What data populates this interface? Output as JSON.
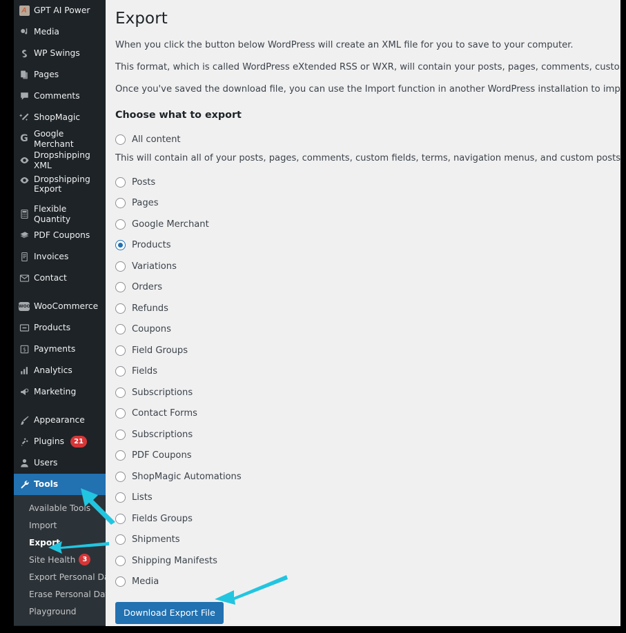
{
  "theme": {
    "sidebar_bg": "#1d2327",
    "submenu_bg": "#2c3338",
    "content_bg": "#f0f0f1",
    "accent_blue": "#2271b1",
    "badge_red": "#d63638",
    "arrow_cyan": "#22c5e0",
    "page_border": "#000000"
  },
  "sidebar": {
    "items": [
      {
        "label": "GPT AI Power",
        "icon": "ai-power-icon",
        "badge": null
      },
      {
        "label": "Media",
        "icon": "media-icon",
        "badge": null
      },
      {
        "label": "WP Swings",
        "icon": "wp-swings-icon",
        "badge": null
      },
      {
        "label": "Pages",
        "icon": "pages-icon",
        "badge": null
      },
      {
        "label": "Comments",
        "icon": "comments-icon",
        "badge": null
      },
      {
        "label": "ShopMagic",
        "icon": "magic-wand-icon",
        "badge": null
      },
      {
        "label": "Google Merchant",
        "icon": "google-g-icon",
        "badge": null
      },
      {
        "label": "Dropshipping XML",
        "icon": "eye-icon",
        "badge": null
      },
      {
        "label": "Dropshipping Export",
        "icon": "eye-icon",
        "badge": null,
        "two_line": true
      },
      {
        "label": "Flexible Quantity",
        "icon": "calculator-icon",
        "badge": null
      },
      {
        "label": "PDF Coupons",
        "icon": "coupon-icon",
        "badge": null
      },
      {
        "label": "Invoices",
        "icon": "invoice-icon",
        "badge": null
      },
      {
        "label": "Contact",
        "icon": "envelope-icon",
        "badge": null
      },
      {
        "label": "WooCommerce",
        "icon": "woocommerce-icon",
        "badge": null,
        "separator_before": true
      },
      {
        "label": "Products",
        "icon": "product-box-icon",
        "badge": null
      },
      {
        "label": "Payments",
        "icon": "payments-icon",
        "badge": null
      },
      {
        "label": "Analytics",
        "icon": "analytics-bars-icon",
        "badge": null
      },
      {
        "label": "Marketing",
        "icon": "megaphone-icon",
        "badge": null
      },
      {
        "label": "Appearance",
        "icon": "paintbrush-icon",
        "badge": null,
        "separator_before": true
      },
      {
        "label": "Plugins",
        "icon": "plug-icon",
        "badge": "21"
      },
      {
        "label": "Users",
        "icon": "user-icon",
        "badge": null
      },
      {
        "label": "Tools",
        "icon": "wrench-icon",
        "badge": null,
        "current": true
      }
    ],
    "submenu": [
      {
        "label": "Available Tools",
        "current": false
      },
      {
        "label": "Import",
        "current": false
      },
      {
        "label": "Export",
        "current": true
      },
      {
        "label": "Site Health",
        "current": false,
        "badge": "3"
      },
      {
        "label": "Export Personal Data",
        "current": false
      },
      {
        "label": "Erase Personal Data",
        "current": false
      },
      {
        "label": "Playground",
        "current": false
      }
    ]
  },
  "main": {
    "title": "Export",
    "paragraphs": [
      "When you click the button below WordPress will create an XML file for you to save to your computer.",
      "This format, which is called WordPress eXtended RSS or WXR, will contain your posts, pages, comments, custom fields, categories, and tags.",
      "Once you've saved the download file, you can use the Import function in another WordPress installation to import the content from this site."
    ],
    "choose_heading": "Choose what to export",
    "all_content": {
      "label": "All content",
      "checked": false,
      "description": "This will contain all of your posts, pages, comments, custom fields, terms, navigation menus, and custom posts."
    },
    "options": [
      {
        "label": "Posts",
        "checked": false
      },
      {
        "label": "Pages",
        "checked": false
      },
      {
        "label": "Google Merchant",
        "checked": false
      },
      {
        "label": "Products",
        "checked": true
      },
      {
        "label": "Variations",
        "checked": false
      },
      {
        "label": "Orders",
        "checked": false
      },
      {
        "label": "Refunds",
        "checked": false
      },
      {
        "label": "Coupons",
        "checked": false
      },
      {
        "label": "Field Groups",
        "checked": false
      },
      {
        "label": "Fields",
        "checked": false
      },
      {
        "label": "Subscriptions",
        "checked": false
      },
      {
        "label": "Contact Forms",
        "checked": false
      },
      {
        "label": "Subscriptions",
        "checked": false
      },
      {
        "label": "PDF Coupons",
        "checked": false
      },
      {
        "label": "ShopMagic Automations",
        "checked": false
      },
      {
        "label": "Lists",
        "checked": false
      },
      {
        "label": "Fields Groups",
        "checked": false
      },
      {
        "label": "Shipments",
        "checked": false
      },
      {
        "label": "Shipping Manifests",
        "checked": false
      },
      {
        "label": "Media",
        "checked": false
      }
    ],
    "download_button": "Download Export File"
  },
  "annotations": [
    {
      "name": "arrow-to-tools",
      "target": "Tools"
    },
    {
      "name": "arrow-to-export",
      "target": "Export"
    },
    {
      "name": "arrow-to-download-button",
      "target": "Download Export File"
    }
  ]
}
